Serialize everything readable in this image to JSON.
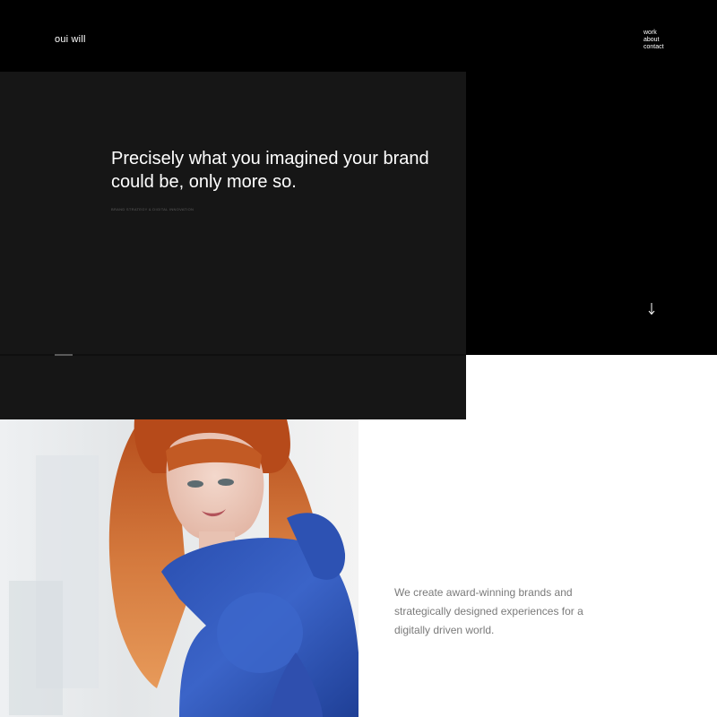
{
  "header": {
    "logo": "oui will",
    "nav": [
      {
        "label": "work"
      },
      {
        "label": "about"
      },
      {
        "label": "contact"
      }
    ]
  },
  "hero": {
    "headline": "Precisely what you imagined your brand could be, only more so.",
    "tagline": "BRAND STRATEGY & DIGITAL INNOVATION",
    "scroll_icon": "arrow-down-icon"
  },
  "intro": {
    "text": "We create award-winning brands and strategically designed experiences for a digitally driven world."
  },
  "colors": {
    "background": "#000000",
    "panel": "#161616",
    "section_light": "#ffffff",
    "body_text": "#7a7a7a",
    "hair": "#c9652e",
    "top": "#2f55b5"
  }
}
